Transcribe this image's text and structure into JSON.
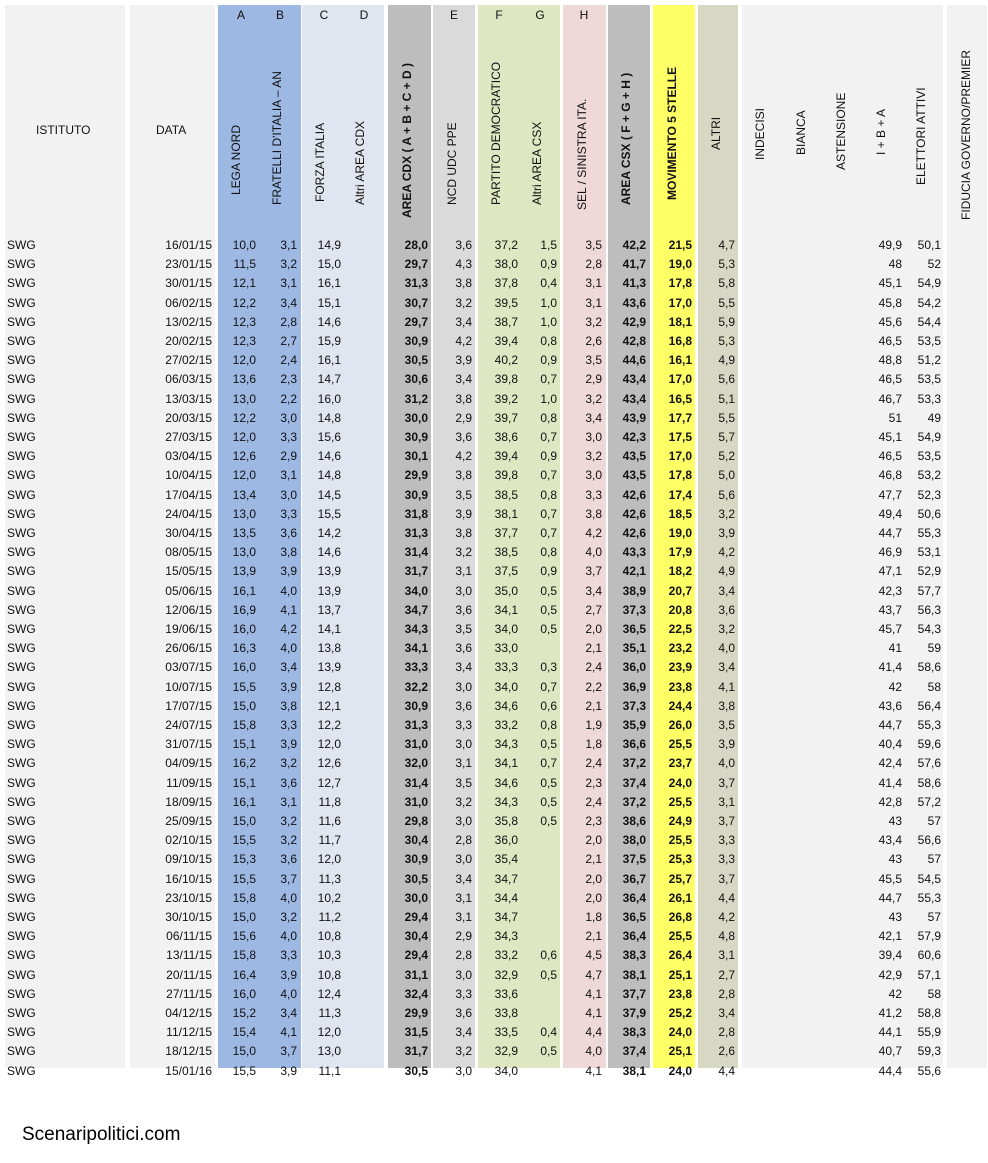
{
  "header": {
    "istituto": "ISTITUTO",
    "data": "DATA",
    "lega": "LEGA NORD",
    "fdi": "FRATELLI D'ITALIA – AN",
    "fi": "FORZA ITALIA",
    "altri_cdx": "Altri AREA CDX",
    "area_cdx": "AREA CDX   ( A + B + C + D )",
    "ncd": "NCD UDC PPE",
    "pd": "PARTITO DEMOCRATICO",
    "altri_csx": "Altri AREA CSX",
    "sel": "SEL / SINISTRA ITA.",
    "area_csx": "AREA CSX   ( F + G + H )",
    "m5s": "MOVIMENTO 5 STELLE",
    "altri": "ALTRI",
    "indecisi": "INDECISI",
    "bianca": "BIANCA",
    "astensione": "ASTENSIONE",
    "iba": "I + B + A",
    "elettori": "ELETTORI ATTIVI",
    "fiducia": "FIDUCIA GOVERNO/PREMIER"
  },
  "letters": {
    "a": "A",
    "b": "B",
    "c": "C",
    "d": "D",
    "e": "E",
    "f": "F",
    "g": "G",
    "h": "H"
  },
  "colors": {
    "gray_col": "#f2f2f2",
    "lega_fdi": "#9eb8e4",
    "fi_altri": "#e1e5f0",
    "area_cdx": "#bdbdbd",
    "ncd": "#dadada",
    "pd_csx": "#dde7c1",
    "sel": "#eed8d8",
    "area_csx": "#bdbdbd",
    "m5s": "#ffff66",
    "altri": "#d8d7c3"
  },
  "rows": [
    [
      "SWG",
      "16/01/15",
      "10,0",
      "3,1",
      "14,9",
      "",
      "28,0",
      "3,6",
      "37,2",
      "1,5",
      "3,5",
      "42,2",
      "21,5",
      "4,7",
      "49,9",
      "50,1"
    ],
    [
      "SWG",
      "23/01/15",
      "11,5",
      "3,2",
      "15,0",
      "",
      "29,7",
      "4,3",
      "38,0",
      "0,9",
      "2,8",
      "41,7",
      "19,0",
      "5,3",
      "48",
      "52"
    ],
    [
      "SWG",
      "30/01/15",
      "12,1",
      "3,1",
      "16,1",
      "",
      "31,3",
      "3,8",
      "37,8",
      "0,4",
      "3,1",
      "41,3",
      "17,8",
      "5,8",
      "45,1",
      "54,9"
    ],
    [
      "SWG",
      "06/02/15",
      "12,2",
      "3,4",
      "15,1",
      "",
      "30,7",
      "3,2",
      "39,5",
      "1,0",
      "3,1",
      "43,6",
      "17,0",
      "5,5",
      "45,8",
      "54,2"
    ],
    [
      "SWG",
      "13/02/15",
      "12,3",
      "2,8",
      "14,6",
      "",
      "29,7",
      "3,4",
      "38,7",
      "1,0",
      "3,2",
      "42,9",
      "18,1",
      "5,9",
      "45,6",
      "54,4"
    ],
    [
      "SWG",
      "20/02/15",
      "12,3",
      "2,7",
      "15,9",
      "",
      "30,9",
      "4,2",
      "39,4",
      "0,8",
      "2,6",
      "42,8",
      "16,8",
      "5,3",
      "46,5",
      "53,5"
    ],
    [
      "SWG",
      "27/02/15",
      "12,0",
      "2,4",
      "16,1",
      "",
      "30,5",
      "3,9",
      "40,2",
      "0,9",
      "3,5",
      "44,6",
      "16,1",
      "4,9",
      "48,8",
      "51,2"
    ],
    [
      "SWG",
      "06/03/15",
      "13,6",
      "2,3",
      "14,7",
      "",
      "30,6",
      "3,4",
      "39,8",
      "0,7",
      "2,9",
      "43,4",
      "17,0",
      "5,6",
      "46,5",
      "53,5"
    ],
    [
      "SWG",
      "13/03/15",
      "13,0",
      "2,2",
      "16,0",
      "",
      "31,2",
      "3,8",
      "39,2",
      "1,0",
      "3,2",
      "43,4",
      "16,5",
      "5,1",
      "46,7",
      "53,3"
    ],
    [
      "SWG",
      "20/03/15",
      "12,2",
      "3,0",
      "14,8",
      "",
      "30,0",
      "2,9",
      "39,7",
      "0,8",
      "3,4",
      "43,9",
      "17,7",
      "5,5",
      "51",
      "49"
    ],
    [
      "SWG",
      "27/03/15",
      "12,0",
      "3,3",
      "15,6",
      "",
      "30,9",
      "3,6",
      "38,6",
      "0,7",
      "3,0",
      "42,3",
      "17,5",
      "5,7",
      "45,1",
      "54,9"
    ],
    [
      "SWG",
      "03/04/15",
      "12,6",
      "2,9",
      "14,6",
      "",
      "30,1",
      "4,2",
      "39,4",
      "0,9",
      "3,2",
      "43,5",
      "17,0",
      "5,2",
      "46,5",
      "53,5"
    ],
    [
      "SWG",
      "10/04/15",
      "12,0",
      "3,1",
      "14,8",
      "",
      "29,9",
      "3,8",
      "39,8",
      "0,7",
      "3,0",
      "43,5",
      "17,8",
      "5,0",
      "46,8",
      "53,2"
    ],
    [
      "SWG",
      "17/04/15",
      "13,4",
      "3,0",
      "14,5",
      "",
      "30,9",
      "3,5",
      "38,5",
      "0,8",
      "3,3",
      "42,6",
      "17,4",
      "5,6",
      "47,7",
      "52,3"
    ],
    [
      "SWG",
      "24/04/15",
      "13,0",
      "3,3",
      "15,5",
      "",
      "31,8",
      "3,9",
      "38,1",
      "0,7",
      "3,8",
      "42,6",
      "18,5",
      "3,2",
      "49,4",
      "50,6"
    ],
    [
      "SWG",
      "30/04/15",
      "13,5",
      "3,6",
      "14,2",
      "",
      "31,3",
      "3,8",
      "37,7",
      "0,7",
      "4,2",
      "42,6",
      "19,0",
      "3,9",
      "44,7",
      "55,3"
    ],
    [
      "SWG",
      "08/05/15",
      "13,0",
      "3,8",
      "14,6",
      "",
      "31,4",
      "3,2",
      "38,5",
      "0,8",
      "4,0",
      "43,3",
      "17,9",
      "4,2",
      "46,9",
      "53,1"
    ],
    [
      "SWG",
      "15/05/15",
      "13,9",
      "3,9",
      "13,9",
      "",
      "31,7",
      "3,1",
      "37,5",
      "0,9",
      "3,7",
      "42,1",
      "18,2",
      "4,9",
      "47,1",
      "52,9"
    ],
    [
      "SWG",
      "05/06/15",
      "16,1",
      "4,0",
      "13,9",
      "",
      "34,0",
      "3,0",
      "35,0",
      "0,5",
      "3,4",
      "38,9",
      "20,7",
      "3,4",
      "42,3",
      "57,7"
    ],
    [
      "SWG",
      "12/06/15",
      "16,9",
      "4,1",
      "13,7",
      "",
      "34,7",
      "3,6",
      "34,1",
      "0,5",
      "2,7",
      "37,3",
      "20,8",
      "3,6",
      "43,7",
      "56,3"
    ],
    [
      "SWG",
      "19/06/15",
      "16,0",
      "4,2",
      "14,1",
      "",
      "34,3",
      "3,5",
      "34,0",
      "0,5",
      "2,0",
      "36,5",
      "22,5",
      "3,2",
      "45,7",
      "54,3"
    ],
    [
      "SWG",
      "26/06/15",
      "16,3",
      "4,0",
      "13,8",
      "",
      "34,1",
      "3,6",
      "33,0",
      "",
      "2,1",
      "35,1",
      "23,2",
      "4,0",
      "41",
      "59"
    ],
    [
      "SWG",
      "03/07/15",
      "16,0",
      "3,4",
      "13,9",
      "",
      "33,3",
      "3,4",
      "33,3",
      "0,3",
      "2,4",
      "36,0",
      "23,9",
      "3,4",
      "41,4",
      "58,6"
    ],
    [
      "SWG",
      "10/07/15",
      "15,5",
      "3,9",
      "12,8",
      "",
      "32,2",
      "3,0",
      "34,0",
      "0,7",
      "2,2",
      "36,9",
      "23,8",
      "4,1",
      "42",
      "58"
    ],
    [
      "SWG",
      "17/07/15",
      "15,0",
      "3,8",
      "12,1",
      "",
      "30,9",
      "3,6",
      "34,6",
      "0,6",
      "2,1",
      "37,3",
      "24,4",
      "3,8",
      "43,6",
      "56,4"
    ],
    [
      "SWG",
      "24/07/15",
      "15,8",
      "3,3",
      "12,2",
      "",
      "31,3",
      "3,3",
      "33,2",
      "0,8",
      "1,9",
      "35,9",
      "26,0",
      "3,5",
      "44,7",
      "55,3"
    ],
    [
      "SWG",
      "31/07/15",
      "15,1",
      "3,9",
      "12,0",
      "",
      "31,0",
      "3,0",
      "34,3",
      "0,5",
      "1,8",
      "36,6",
      "25,5",
      "3,9",
      "40,4",
      "59,6"
    ],
    [
      "SWG",
      "04/09/15",
      "16,2",
      "3,2",
      "12,6",
      "",
      "32,0",
      "3,1",
      "34,1",
      "0,7",
      "2,4",
      "37,2",
      "23,7",
      "4,0",
      "42,4",
      "57,6"
    ],
    [
      "SWG",
      "11/09/15",
      "15,1",
      "3,6",
      "12,7",
      "",
      "31,4",
      "3,5",
      "34,6",
      "0,5",
      "2,3",
      "37,4",
      "24,0",
      "3,7",
      "41,4",
      "58,6"
    ],
    [
      "SWG",
      "18/09/15",
      "16,1",
      "3,1",
      "11,8",
      "",
      "31,0",
      "3,2",
      "34,3",
      "0,5",
      "2,4",
      "37,2",
      "25,5",
      "3,1",
      "42,8",
      "57,2"
    ],
    [
      "SWG",
      "25/09/15",
      "15,0",
      "3,2",
      "11,6",
      "",
      "29,8",
      "3,0",
      "35,8",
      "0,5",
      "2,3",
      "38,6",
      "24,9",
      "3,7",
      "43",
      "57"
    ],
    [
      "SWG",
      "02/10/15",
      "15,5",
      "3,2",
      "11,7",
      "",
      "30,4",
      "2,8",
      "36,0",
      "",
      "2,0",
      "38,0",
      "25,5",
      "3,3",
      "43,4",
      "56,6"
    ],
    [
      "SWG",
      "09/10/15",
      "15,3",
      "3,6",
      "12,0",
      "",
      "30,9",
      "3,0",
      "35,4",
      "",
      "2,1",
      "37,5",
      "25,3",
      "3,3",
      "43",
      "57"
    ],
    [
      "SWG",
      "16/10/15",
      "15,5",
      "3,7",
      "11,3",
      "",
      "30,5",
      "3,4",
      "34,7",
      "",
      "2,0",
      "36,7",
      "25,7",
      "3,7",
      "45,5",
      "54,5"
    ],
    [
      "SWG",
      "23/10/15",
      "15,8",
      "4,0",
      "10,2",
      "",
      "30,0",
      "3,1",
      "34,4",
      "",
      "2,0",
      "36,4",
      "26,1",
      "4,4",
      "44,7",
      "55,3"
    ],
    [
      "SWG",
      "30/10/15",
      "15,0",
      "3,2",
      "11,2",
      "",
      "29,4",
      "3,1",
      "34,7",
      "",
      "1,8",
      "36,5",
      "26,8",
      "4,2",
      "43",
      "57"
    ],
    [
      "SWG",
      "06/11/15",
      "15,6",
      "4,0",
      "10,8",
      "",
      "30,4",
      "2,9",
      "34,3",
      "",
      "2,1",
      "36,4",
      "25,5",
      "4,8",
      "42,1",
      "57,9"
    ],
    [
      "SWG",
      "13/11/15",
      "15,8",
      "3,3",
      "10,3",
      "",
      "29,4",
      "2,8",
      "33,2",
      "0,6",
      "4,5",
      "38,3",
      "26,4",
      "3,1",
      "39,4",
      "60,6"
    ],
    [
      "SWG",
      "20/11/15",
      "16,4",
      "3,9",
      "10,8",
      "",
      "31,1",
      "3,0",
      "32,9",
      "0,5",
      "4,7",
      "38,1",
      "25,1",
      "2,7",
      "42,9",
      "57,1"
    ],
    [
      "SWG",
      "27/11/15",
      "16,0",
      "4,0",
      "12,4",
      "",
      "32,4",
      "3,3",
      "33,6",
      "",
      "4,1",
      "37,7",
      "23,8",
      "2,8",
      "42",
      "58"
    ],
    [
      "SWG",
      "04/12/15",
      "15,2",
      "3,4",
      "11,3",
      "",
      "29,9",
      "3,6",
      "33,8",
      "",
      "4,1",
      "37,9",
      "25,2",
      "3,4",
      "41,2",
      "58,8"
    ],
    [
      "SWG",
      "11/12/15",
      "15,4",
      "4,1",
      "12,0",
      "",
      "31,5",
      "3,4",
      "33,5",
      "0,4",
      "4,4",
      "38,3",
      "24,0",
      "2,8",
      "44,1",
      "55,9"
    ],
    [
      "SWG",
      "18/12/15",
      "15,0",
      "3,7",
      "13,0",
      "",
      "31,7",
      "3,2",
      "32,9",
      "0,5",
      "4,0",
      "37,4",
      "25,1",
      "2,6",
      "40,7",
      "59,3"
    ],
    [
      "SWG",
      "15/01/16",
      "15,5",
      "3,9",
      "11,1",
      "",
      "30,5",
      "3,0",
      "34,0",
      "",
      "4,1",
      "38,1",
      "24,0",
      "4,4",
      "44,4",
      "55,6"
    ]
  ],
  "footer": {
    "brand": "Scenaripolitici.com"
  }
}
